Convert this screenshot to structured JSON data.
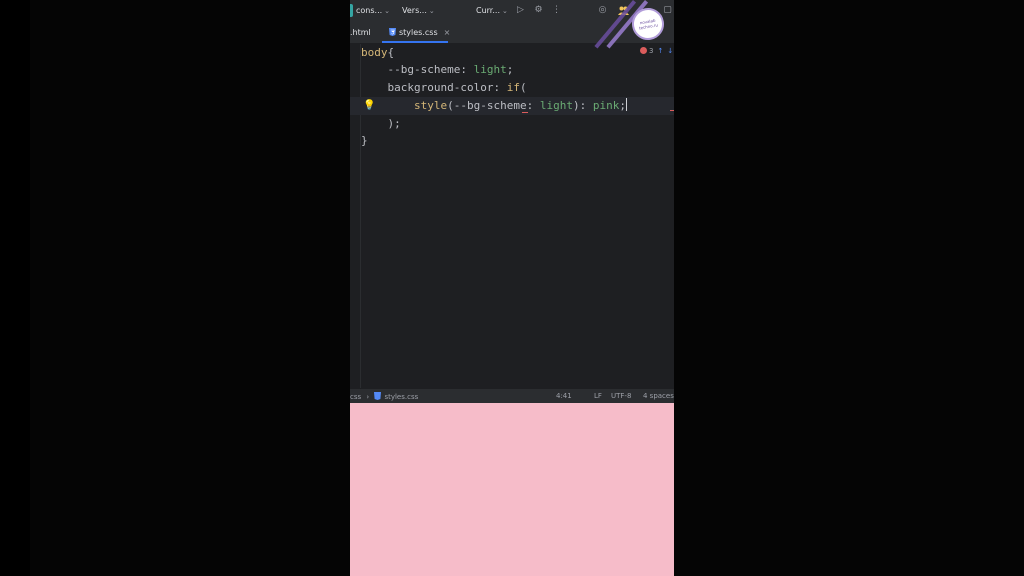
{
  "toolbar": {
    "project": "cons...",
    "vcs": "Vers...",
    "run_config": "Curr..."
  },
  "tabs": [
    {
      "label": ".html"
    },
    {
      "label": "styles.css"
    }
  ],
  "problems": {
    "error_count": "3"
  },
  "editor": {
    "lines": [
      {
        "indent": "",
        "parts": [
          [
            "kw",
            "body"
          ],
          [
            "paren",
            "{"
          ]
        ]
      },
      {
        "indent": "    ",
        "parts": [
          [
            "prop",
            "--bg-scheme: "
          ],
          [
            "val",
            "light"
          ],
          [
            "paren",
            ";"
          ]
        ]
      },
      {
        "indent": "    ",
        "parts": [
          [
            "prop",
            "background-color: "
          ],
          [
            "fn2",
            "if"
          ],
          [
            "paren",
            "("
          ]
        ]
      },
      {
        "indent": "        ",
        "parts": [
          [
            "fn2",
            "style"
          ],
          [
            "paren",
            "(--bg-scheme"
          ],
          [
            "prop",
            ": "
          ],
          [
            "val",
            "light"
          ],
          [
            "paren",
            "): "
          ],
          [
            "val",
            "pink"
          ],
          [
            "paren",
            ";"
          ]
        ]
      },
      {
        "indent": "    ",
        "parts": [
          [
            "paren",
            ");"
          ]
        ]
      },
      {
        "indent": "",
        "parts": [
          [
            "paren",
            "}"
          ]
        ]
      }
    ]
  },
  "statusbar": {
    "breadcrumb_parent": "css",
    "breadcrumb_file": "styles.css",
    "cursor_position": "4:41",
    "line_ending": "LF",
    "encoding": "UTF-8",
    "indent": "4 spaces"
  },
  "logo": {
    "text_top": "novalab",
    "text_bottom": "techno.ru"
  },
  "colors": {
    "preview_background": "#f6bcc9",
    "editor_background": "#1e1f22",
    "toolbar_background": "#2b2d30",
    "accent_blue": "#3574f0"
  }
}
